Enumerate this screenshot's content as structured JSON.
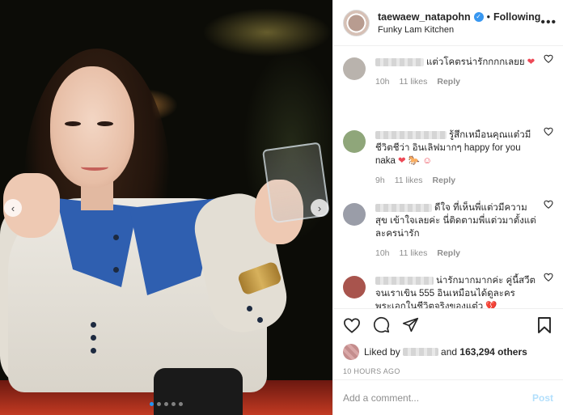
{
  "post": {
    "carousel_dots": 5,
    "active_dot": 0
  },
  "header": {
    "username": "taewaew_natapohn",
    "bullet": "•",
    "following_label": "Following",
    "location": "Funky Lam Kitchen",
    "more_label": "•••",
    "verified_icon": "verified-badge-icon"
  },
  "comments": [
    {
      "text": "แต่วโคตรน่ารักกกกเลยย",
      "emoji": "❤",
      "time": "10h",
      "likes": "11 likes",
      "reply": "Reply",
      "avatar_color": "#b9b3ad"
    },
    {
      "text": "รู้สึกเหมือนคุณแต๋วมีชีวิตชีว่า อินเลิฟมากๆ happy for you naka",
      "emoji": "❤ 🐎 ☺",
      "time": "9h",
      "likes": "11 likes",
      "reply": "Reply",
      "avatar_color": "#8fa67a"
    },
    {
      "text": "ดีใจ ที่เห็นพี่แต่วมีความสุข เข้าใจเลยค่ะ นี่ติดตามพี่แต่วมาตั้งแต่ละครน่ารัก",
      "emoji": "",
      "time": "10h",
      "likes": "11 likes",
      "reply": "Reply",
      "avatar_color": "#9a9da8"
    },
    {
      "text": "น่ารักมากมากค่ะ คู่นี้สวีตจนเราเขิน 555 อินเหมือนได้ดูละครพระเอกในชีวิตจริงของแต๋ว",
      "emoji": "💔",
      "time": "",
      "likes": "",
      "reply": "",
      "avatar_color": "#a8544d"
    }
  ],
  "actions": {
    "like_icon": "heart-outline-icon",
    "comment_icon": "comment-bubble-icon",
    "share_icon": "paper-plane-icon",
    "save_icon": "bookmark-icon"
  },
  "likes": {
    "prefix": "Liked by",
    "middle": "and",
    "count": "163,294 others"
  },
  "timestamp": "10 HOURS AGO",
  "add_comment": {
    "placeholder": "Add a comment...",
    "post_label": "Post"
  },
  "colors": {
    "link_blue": "#3897f0",
    "heart_red": "#ed4956",
    "muted": "#8e8e8e",
    "post_disabled": "#b2dffc"
  }
}
